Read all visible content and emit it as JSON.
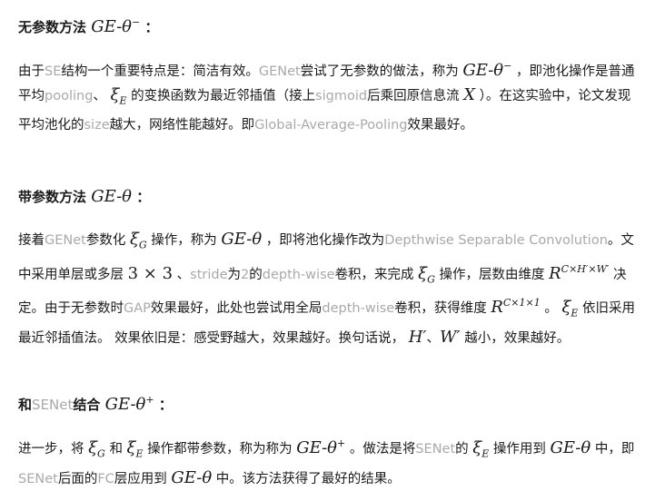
{
  "s1": {
    "heading_text": "无参数方法",
    "heading_math": "GE-θ",
    "heading_sup": "−",
    "heading_colon": "：",
    "p": {
      "t1": "由于",
      "se": "SE",
      "t2": "结构一个重要特点是：简洁有效。",
      "genet": "GENet",
      "t3": "尝试了无参数的做法，称为",
      "m1": "GE-θ",
      "m1_sup": "−",
      "t4": "，即池化操作是普通平均",
      "pooling": "pooling",
      "t5": "、",
      "xi": "ξ",
      "xi_sub": "E",
      "t6": "的变换函数为最近邻插值（接上",
      "sigmoid": "sigmoid",
      "t7": "后乘回原信息流",
      "x": "X",
      "t8": "）。在这实验中，论文发现平均池化的",
      "size": "size",
      "t9": "越大，网络性能越好。即",
      "gap": "Global-Average-Pooling",
      "t10": "效果最好。"
    }
  },
  "s2": {
    "heading_text": "带参数方法",
    "heading_math": "GE-θ",
    "heading_colon": "：",
    "p": {
      "t1": "接着",
      "genet": "GENet",
      "t2": "参数化",
      "xi": "ξ",
      "xi_sub": "G",
      "t3": "操作，称为",
      "m1": "GE-θ",
      "t4": "，即将池化操作改为",
      "dsc": "Depthwise Separable Convolution",
      "t5": "。文中采用单层或多层",
      "k": "3 × 3",
      "t6": "、",
      "stride": "stride",
      "t7": "为",
      "two": "2",
      "t8": "的",
      "dw": "depth-wise",
      "t9": "卷积，来完成",
      "xi2": "ξ",
      "xi2_sub": "G",
      "t10": "操作，层数由维度",
      "r1": "R",
      "r1_sup": "C×H′×W′",
      "t11": "决定。由于无参数时",
      "gapname": "GAP",
      "t12": "效果最好，此处也尝试用全局",
      "dw2": "depth-wise",
      "t13": "卷积，获得维度",
      "r2": "R",
      "r2_sup": "C×1×1",
      "t14": "。",
      "xi3": "ξ",
      "xi3_sub": "E",
      "t15": "依旧采用最近邻插值法。 效果依旧是：感受野越大，效果越好。换句话说，",
      "h": "H′",
      "t16": "、",
      "w": "W′",
      "t17": "越小，效果越好。"
    }
  },
  "s3": {
    "heading_t1": "和",
    "heading_senet": "SENet",
    "heading_t2": "结合",
    "heading_math": "GE-θ",
    "heading_sup": "+",
    "heading_colon": "：",
    "p": {
      "t1": "进一步，将",
      "xi": "ξ",
      "xi_sub": "G",
      "t2": "和",
      "xi2": "ξ",
      "xi2_sub": "E",
      "t3": "操作都带参数，称为称为",
      "m1": "GE-θ",
      "m1_sup": "+",
      "t4": "。做法是将",
      "senet": "SENet",
      "t5": "的",
      "xi3": "ξ",
      "xi3_sub": "E",
      "t6": "操作用到",
      "m2": "GE-θ",
      "t7": "中，即",
      "senet2": "SENet",
      "t8": "后面的",
      "fc": "FC",
      "t9": "层应用到",
      "m3": "GE-θ",
      "t10": "中。该方法获得了最好的结果。"
    }
  }
}
